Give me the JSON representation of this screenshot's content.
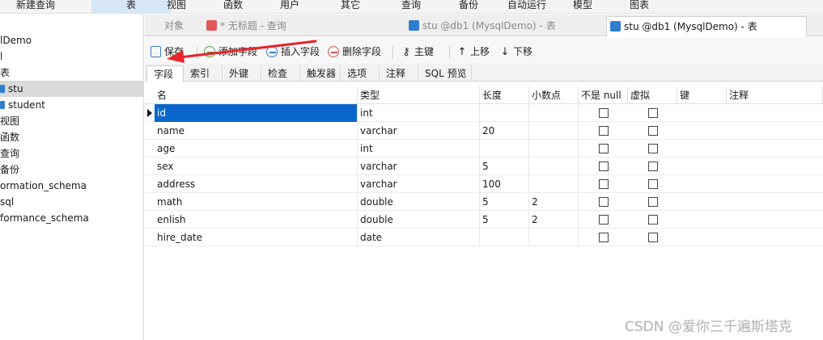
{
  "top_menu": [
    "新建查询",
    "表",
    "视图",
    "函数",
    "用户",
    "其它",
    "查询",
    "备份",
    "自动运行",
    "模型",
    "图表"
  ],
  "nav": {
    "items": [
      {
        "label": "lDemo"
      },
      {
        "label": "l"
      },
      {
        "label": "表"
      },
      {
        "label": "stu"
      },
      {
        "label": "student"
      },
      {
        "label": "视图"
      },
      {
        "label": "函数"
      },
      {
        "label": "查询"
      },
      {
        "label": "备份"
      },
      {
        "label": "ormation_schema"
      },
      {
        "label": "sql"
      },
      {
        "label": "formance_schema"
      }
    ]
  },
  "doc_tabs": [
    {
      "label": "对象"
    },
    {
      "label": "* 无标题 - 查询"
    },
    {
      "label": "stu @db1 (MysqlDemo) - 表"
    },
    {
      "label": "stu @db1 (MysqlDemo) - 表"
    }
  ],
  "toolbar": {
    "save": "保存",
    "add_field": "添加字段",
    "insert_field": "插入字段",
    "delete_field": "删除字段",
    "primary_key": "主键",
    "move_up": "上移",
    "move_down": "下移"
  },
  "sub_tabs": [
    "字段",
    "索引",
    "外键",
    "检查",
    "触发器",
    "选项",
    "注释",
    "SQL 预览"
  ],
  "grid": {
    "headers": [
      "名",
      "类型",
      "长度",
      "小数点",
      "不是 null",
      "虚拟",
      "键",
      "注释"
    ],
    "rows": [
      {
        "name": "id",
        "type": "int",
        "length": "",
        "decimals": ""
      },
      {
        "name": "name",
        "type": "varchar",
        "length": "20",
        "decimals": ""
      },
      {
        "name": "age",
        "type": "int",
        "length": "",
        "decimals": ""
      },
      {
        "name": "sex",
        "type": "varchar",
        "length": "5",
        "decimals": ""
      },
      {
        "name": "address",
        "type": "varchar",
        "length": "100",
        "decimals": ""
      },
      {
        "name": "math",
        "type": "double",
        "length": "5",
        "decimals": "2"
      },
      {
        "name": "enlish",
        "type": "double",
        "length": "5",
        "decimals": "2"
      },
      {
        "name": "hire_date",
        "type": "date",
        "length": "",
        "decimals": ""
      }
    ]
  },
  "watermark": "CSDN @爱你三千遍斯塔克",
  "colors": {
    "selection": "#0a66cc",
    "arrow": "#e8232a",
    "table_icon": "#2f7fd0"
  }
}
